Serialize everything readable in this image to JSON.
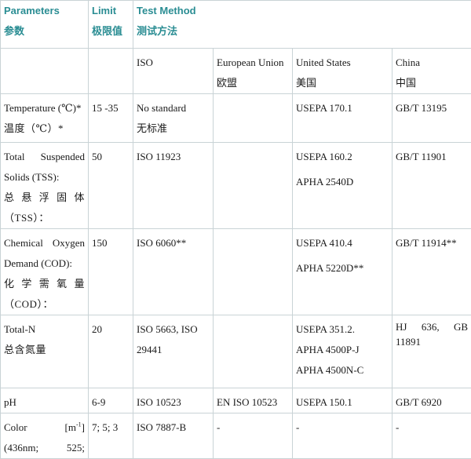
{
  "header": {
    "parameters_en": "Parameters",
    "parameters_cn": "参数",
    "limit_en": "Limit",
    "limit_cn": "极限值",
    "method_en": "Test Method",
    "method_cn": "测试方法"
  },
  "regions": {
    "iso": "ISO",
    "eu_en": "European Union",
    "eu_cn": "欧盟",
    "us_en": "United States",
    "us_cn": "美国",
    "cn_en": "China",
    "cn_cn": "中国"
  },
  "rows": [
    {
      "param_en": "Temperature (℃)*",
      "param_cn": "温度（℃）*",
      "limit": "15 -35",
      "iso_1": "No standard",
      "iso_2": "无标准",
      "eu": "",
      "us_1": "USEPA 170.1",
      "us_2": "",
      "us_3": "",
      "china": "GB/T 13195"
    },
    {
      "param_en_a": "Total Suspended",
      "param_en_b": "Solids (TSS):",
      "param_cn_a": "总悬浮固体",
      "param_cn_b": "（TSS）：",
      "limit": "50",
      "iso_1": "ISO 11923",
      "eu": "",
      "us_1": "USEPA 160.2",
      "us_2": "APHA 2540D",
      "china": "GB/T 11901"
    },
    {
      "param_en_a": "Chemical Oxygen",
      "param_en_b": "Demand (COD):",
      "param_cn_a": "化学需氧量",
      "param_cn_b": "（COD）：",
      "limit": "150",
      "iso_1": "ISO 6060**",
      "eu": "",
      "us_1": "USEPA 410.4",
      "us_2": "APHA 5220D**",
      "china": "GB/T 11914**"
    },
    {
      "param_en": "Total-N",
      "param_cn": "总含氮量",
      "limit": "20",
      "iso_1": "ISO 5663, ISO 29441",
      "eu": "",
      "us_1": "USEPA 351.2.",
      "us_2": "APHA 4500P-J",
      "us_3": "APHA 4500N-C",
      "china_a": "HJ 636, GB",
      "china_b": "11891"
    },
    {
      "param_en": "pH",
      "limit": "6-9",
      "iso_1": "ISO 10523",
      "eu": "EN ISO 10523",
      "us_1": "USEPA 150.1",
      "china": "GB/T 6920"
    },
    {
      "param_en_a": "Color [m",
      "param_en_sup": "-1",
      "param_en_a2": "]",
      "param_en_b": "(436nm; 525;",
      "limit": "7; 5; 3",
      "iso_1": "ISO 7887-B",
      "eu": "-",
      "us_1": "-",
      "china": "-"
    }
  ]
}
